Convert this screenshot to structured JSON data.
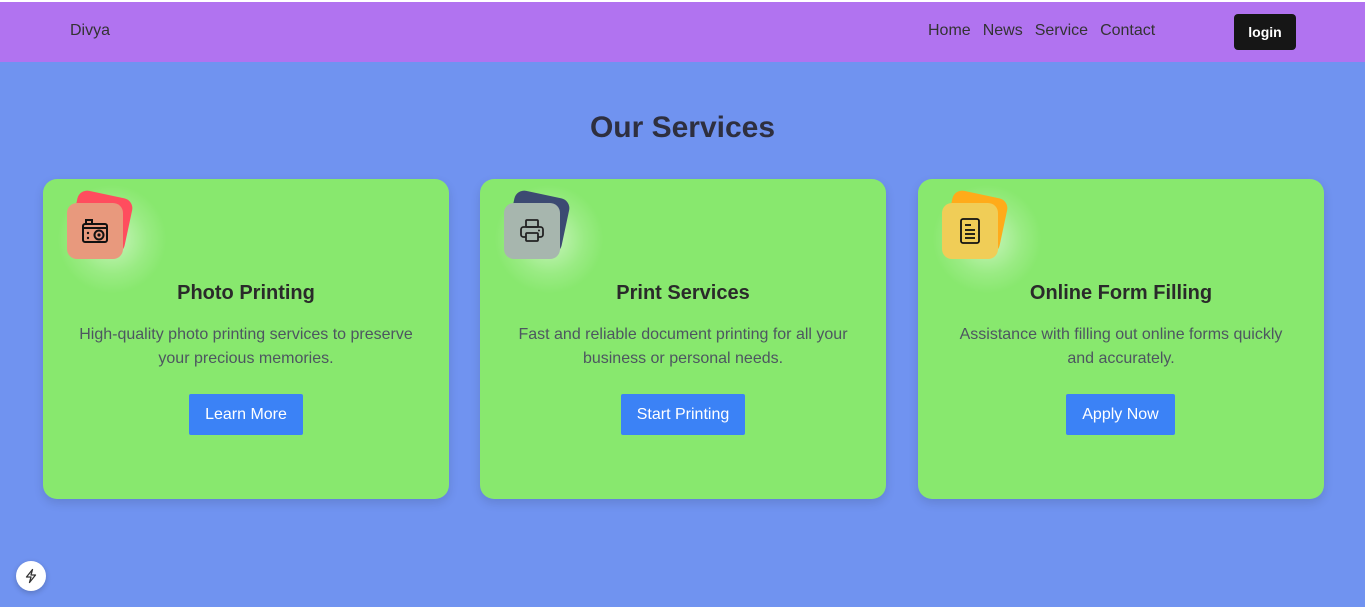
{
  "navbar": {
    "brand": "Divya",
    "links": [
      "Home",
      "News",
      "Service",
      "Contact"
    ],
    "login_label": "login"
  },
  "services": {
    "title": "Our Services",
    "cards": [
      {
        "icon": "camera-icon",
        "title": "Photo Printing",
        "description": "High-quality photo printing services to preserve your precious memories.",
        "button": "Learn More"
      },
      {
        "icon": "printer-icon",
        "title": "Print Services",
        "description": "Fast and reliable document printing for all your business or personal needs.",
        "button": "Start Printing"
      },
      {
        "icon": "form-document-icon",
        "title": "Online Form Filling",
        "description": "Assistance with filling out online forms quickly and accurately.",
        "button": "Apply Now"
      }
    ]
  },
  "floating_button": {
    "icon": "lightning-icon"
  },
  "colors": {
    "navbar": "#b173f0",
    "background": "#7093f0",
    "card": "#88e86e",
    "button": "#3b82f6",
    "login_button": "#161616"
  }
}
